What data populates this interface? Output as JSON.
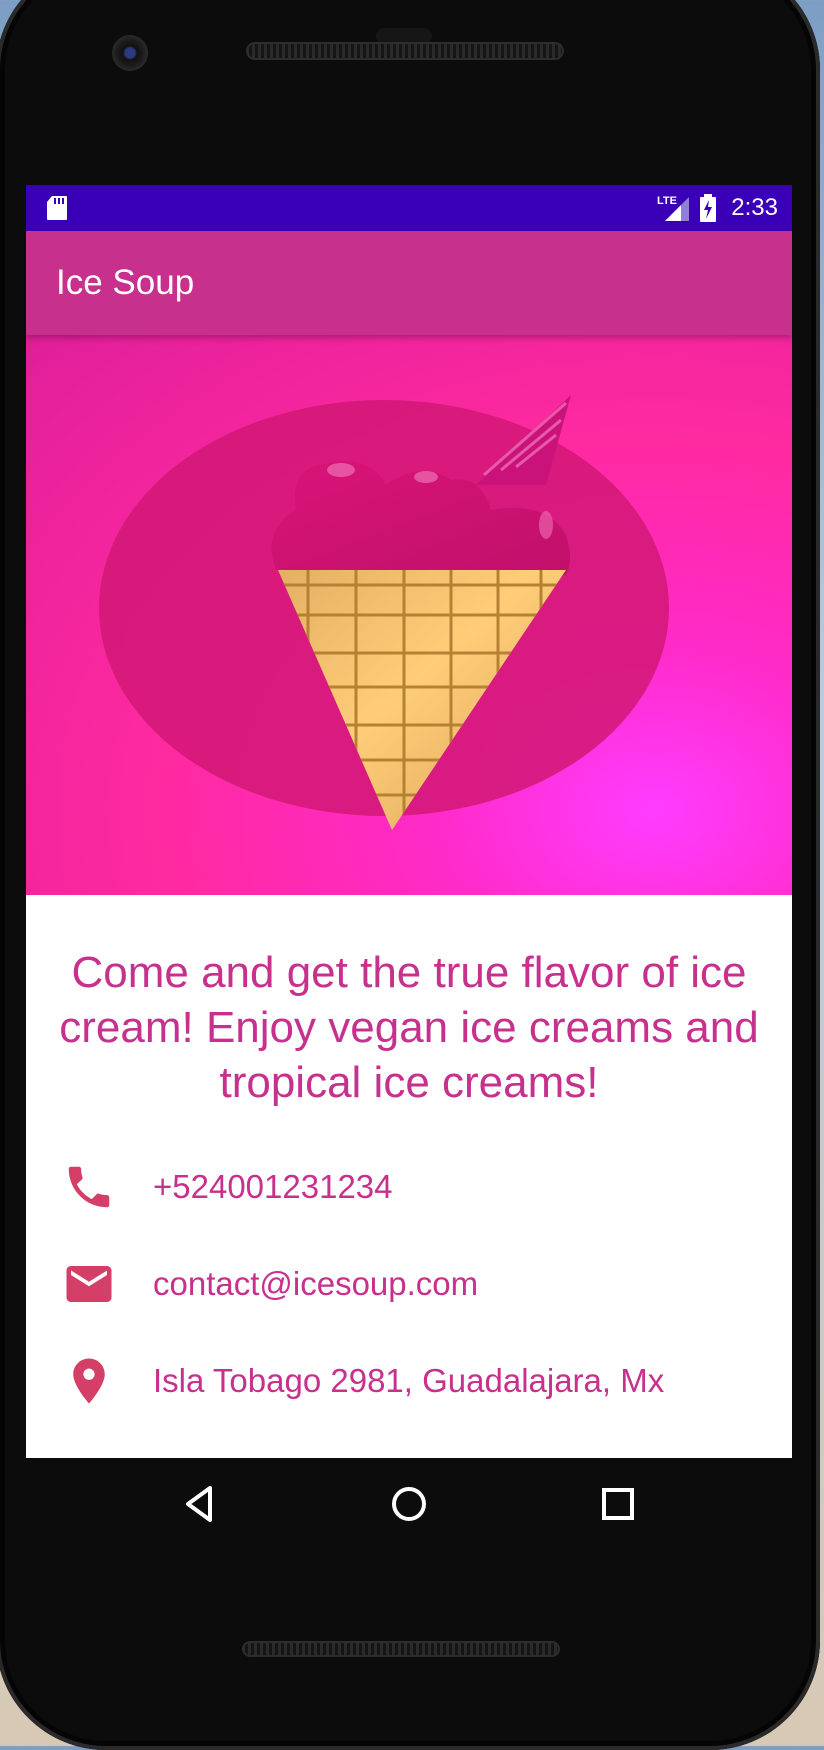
{
  "app": {
    "title": "Ice Soup"
  },
  "statusbar": {
    "time": "2:33",
    "network": "LTE"
  },
  "tagline": "Come and get the true flavor of ice cream! Enjoy vegan ice creams and tropical ice creams!",
  "contacts": [
    {
      "icon": "phone-icon",
      "text": "+524001231234"
    },
    {
      "icon": "email-icon",
      "text": "contact@icesoup.com"
    },
    {
      "icon": "location-pin-icon",
      "text": "Isla Tobago 2981, Guadalajara, Mx"
    }
  ],
  "colors": {
    "primary": "#c7308c",
    "statusbar": "#3a00b8",
    "icon": "#d43f67"
  },
  "navbar": [
    "back-icon",
    "home-icon",
    "recents-icon"
  ]
}
